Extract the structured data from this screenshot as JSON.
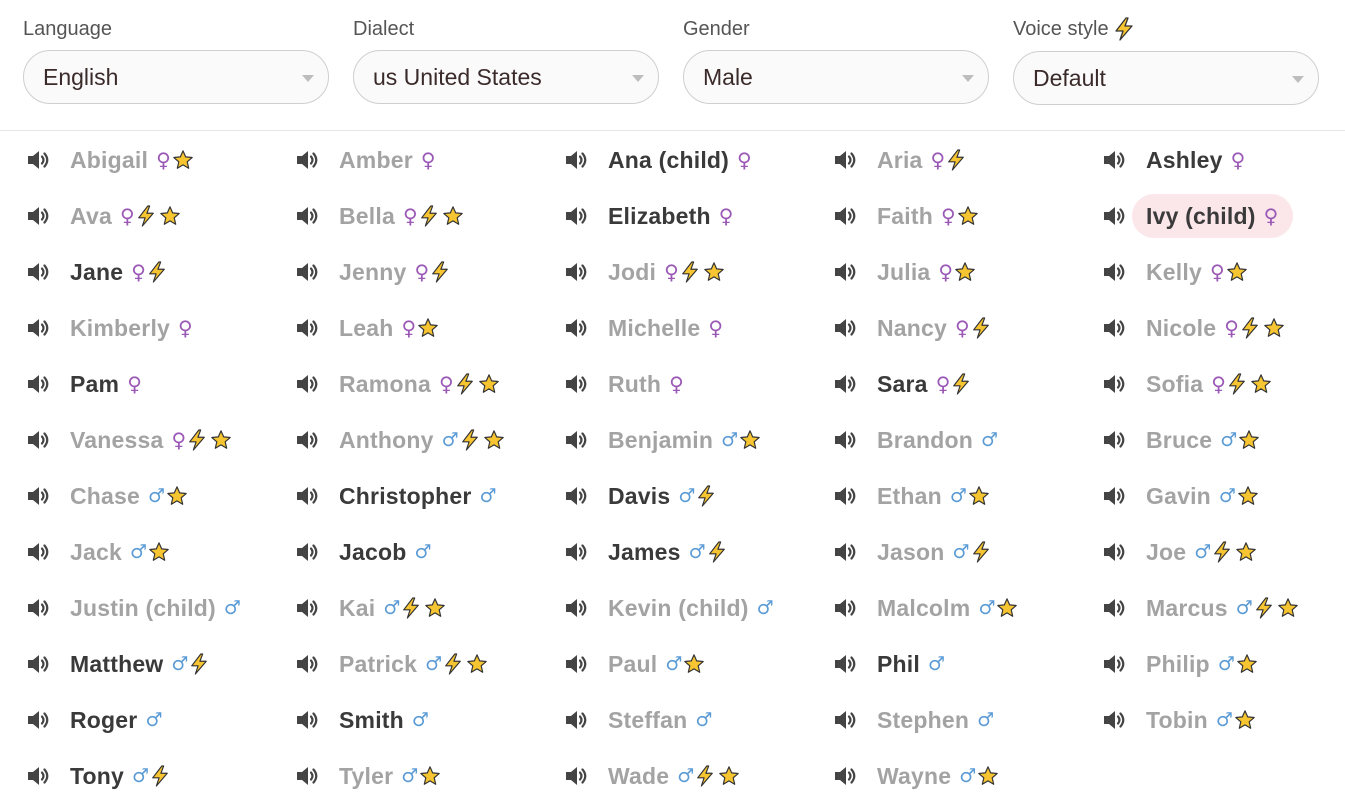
{
  "filters": {
    "language": {
      "label": "Language",
      "value": "English"
    },
    "dialect": {
      "label": "Dialect",
      "value": "us United States"
    },
    "gender": {
      "label": "Gender",
      "value": "Male"
    },
    "voice_style": {
      "label": "Voice style",
      "value": "Default",
      "label_icon": "lightning-icon"
    }
  },
  "colors": {
    "female_symbol": "#9b59b6",
    "male_symbol": "#5b9bd5",
    "bolt": "#f7c531",
    "star": "#f7c531",
    "selected_highlight": "#fbe6ea",
    "dim_text": "#a3a3a3",
    "strong_text": "#3a3a3a"
  },
  "voices": [
    {
      "name": "Abigail",
      "gender": "♀",
      "bolt": false,
      "star": true,
      "dim": true
    },
    {
      "name": "Amber",
      "gender": "♀",
      "bolt": false,
      "star": false,
      "dim": true
    },
    {
      "name": "Ana (child)",
      "gender": "♀",
      "bolt": false,
      "star": false,
      "dim": false
    },
    {
      "name": "Aria",
      "gender": "♀",
      "bolt": true,
      "star": false,
      "dim": true
    },
    {
      "name": "Ashley",
      "gender": "♀",
      "bolt": false,
      "star": false,
      "dim": false
    },
    {
      "name": "Ava",
      "gender": "♀",
      "bolt": true,
      "star": true,
      "dim": true
    },
    {
      "name": "Bella",
      "gender": "♀",
      "bolt": true,
      "star": true,
      "dim": true
    },
    {
      "name": "Elizabeth",
      "gender": "♀",
      "bolt": false,
      "star": false,
      "dim": false
    },
    {
      "name": "Faith",
      "gender": "♀",
      "bolt": false,
      "star": true,
      "dim": true
    },
    {
      "name": "Ivy (child)",
      "gender": "♀",
      "bolt": false,
      "star": false,
      "dim": false,
      "selected": true
    },
    {
      "name": "Jane",
      "gender": "♀",
      "bolt": true,
      "star": false,
      "dim": false
    },
    {
      "name": "Jenny",
      "gender": "♀",
      "bolt": true,
      "star": false,
      "dim": true
    },
    {
      "name": "Jodi",
      "gender": "♀",
      "bolt": true,
      "star": true,
      "dim": true
    },
    {
      "name": "Julia",
      "gender": "♀",
      "bolt": false,
      "star": true,
      "dim": true
    },
    {
      "name": "Kelly",
      "gender": "♀",
      "bolt": false,
      "star": true,
      "dim": true
    },
    {
      "name": "Kimberly",
      "gender": "♀",
      "bolt": false,
      "star": false,
      "dim": true
    },
    {
      "name": "Leah",
      "gender": "♀",
      "bolt": false,
      "star": true,
      "dim": true
    },
    {
      "name": "Michelle",
      "gender": "♀",
      "bolt": false,
      "star": false,
      "dim": true
    },
    {
      "name": "Nancy",
      "gender": "♀",
      "bolt": true,
      "star": false,
      "dim": true
    },
    {
      "name": "Nicole",
      "gender": "♀",
      "bolt": true,
      "star": true,
      "dim": true
    },
    {
      "name": "Pam",
      "gender": "♀",
      "bolt": false,
      "star": false,
      "dim": false
    },
    {
      "name": "Ramona",
      "gender": "♀",
      "bolt": true,
      "star": true,
      "dim": true
    },
    {
      "name": "Ruth",
      "gender": "♀",
      "bolt": false,
      "star": false,
      "dim": true
    },
    {
      "name": "Sara",
      "gender": "♀",
      "bolt": true,
      "star": false,
      "dim": false
    },
    {
      "name": "Sofia",
      "gender": "♀",
      "bolt": true,
      "star": true,
      "dim": true
    },
    {
      "name": "Vanessa",
      "gender": "♀",
      "bolt": true,
      "star": true,
      "dim": true
    },
    {
      "name": "Anthony",
      "gender": "♂",
      "bolt": true,
      "star": true,
      "dim": true
    },
    {
      "name": "Benjamin",
      "gender": "♂",
      "bolt": false,
      "star": true,
      "dim": true
    },
    {
      "name": "Brandon",
      "gender": "♂",
      "bolt": false,
      "star": false,
      "dim": true
    },
    {
      "name": "Bruce",
      "gender": "♂",
      "bolt": false,
      "star": true,
      "dim": true
    },
    {
      "name": "Chase",
      "gender": "♂",
      "bolt": false,
      "star": true,
      "dim": true
    },
    {
      "name": "Christopher",
      "gender": "♂",
      "bolt": false,
      "star": false,
      "dim": false
    },
    {
      "name": "Davis",
      "gender": "♂",
      "bolt": true,
      "star": false,
      "dim": false
    },
    {
      "name": "Ethan",
      "gender": "♂",
      "bolt": false,
      "star": true,
      "dim": true
    },
    {
      "name": "Gavin",
      "gender": "♂",
      "bolt": false,
      "star": true,
      "dim": true
    },
    {
      "name": "Jack",
      "gender": "♂",
      "bolt": false,
      "star": true,
      "dim": true
    },
    {
      "name": "Jacob",
      "gender": "♂",
      "bolt": false,
      "star": false,
      "dim": false
    },
    {
      "name": "James",
      "gender": "♂",
      "bolt": true,
      "star": false,
      "dim": false
    },
    {
      "name": "Jason",
      "gender": "♂",
      "bolt": true,
      "star": false,
      "dim": true
    },
    {
      "name": "Joe",
      "gender": "♂",
      "bolt": true,
      "star": true,
      "dim": true
    },
    {
      "name": "Justin (child)",
      "gender": "♂",
      "bolt": false,
      "star": false,
      "dim": true
    },
    {
      "name": "Kai",
      "gender": "♂",
      "bolt": true,
      "star": true,
      "dim": true
    },
    {
      "name": "Kevin (child)",
      "gender": "♂",
      "bolt": false,
      "star": false,
      "dim": true
    },
    {
      "name": "Malcolm",
      "gender": "♂",
      "bolt": false,
      "star": true,
      "dim": true
    },
    {
      "name": "Marcus",
      "gender": "♂",
      "bolt": true,
      "star": true,
      "dim": true
    },
    {
      "name": "Matthew",
      "gender": "♂",
      "bolt": true,
      "star": false,
      "dim": false
    },
    {
      "name": "Patrick",
      "gender": "♂",
      "bolt": true,
      "star": true,
      "dim": true
    },
    {
      "name": "Paul",
      "gender": "♂",
      "bolt": false,
      "star": true,
      "dim": true
    },
    {
      "name": "Phil",
      "gender": "♂",
      "bolt": false,
      "star": false,
      "dim": false
    },
    {
      "name": "Philip",
      "gender": "♂",
      "bolt": false,
      "star": true,
      "dim": true
    },
    {
      "name": "Roger",
      "gender": "♂",
      "bolt": false,
      "star": false,
      "dim": false
    },
    {
      "name": "Smith",
      "gender": "♂",
      "bolt": false,
      "star": false,
      "dim": false
    },
    {
      "name": "Steffan",
      "gender": "♂",
      "bolt": false,
      "star": false,
      "dim": true
    },
    {
      "name": "Stephen",
      "gender": "♂",
      "bolt": false,
      "star": false,
      "dim": true
    },
    {
      "name": "Tobin",
      "gender": "♂",
      "bolt": false,
      "star": true,
      "dim": true
    },
    {
      "name": "Tony",
      "gender": "♂",
      "bolt": true,
      "star": false,
      "dim": false
    },
    {
      "name": "Tyler",
      "gender": "♂",
      "bolt": false,
      "star": true,
      "dim": true
    },
    {
      "name": "Wade",
      "gender": "♂",
      "bolt": true,
      "star": true,
      "dim": true
    },
    {
      "name": "Wayne",
      "gender": "♂",
      "bolt": false,
      "star": true,
      "dim": true
    }
  ]
}
